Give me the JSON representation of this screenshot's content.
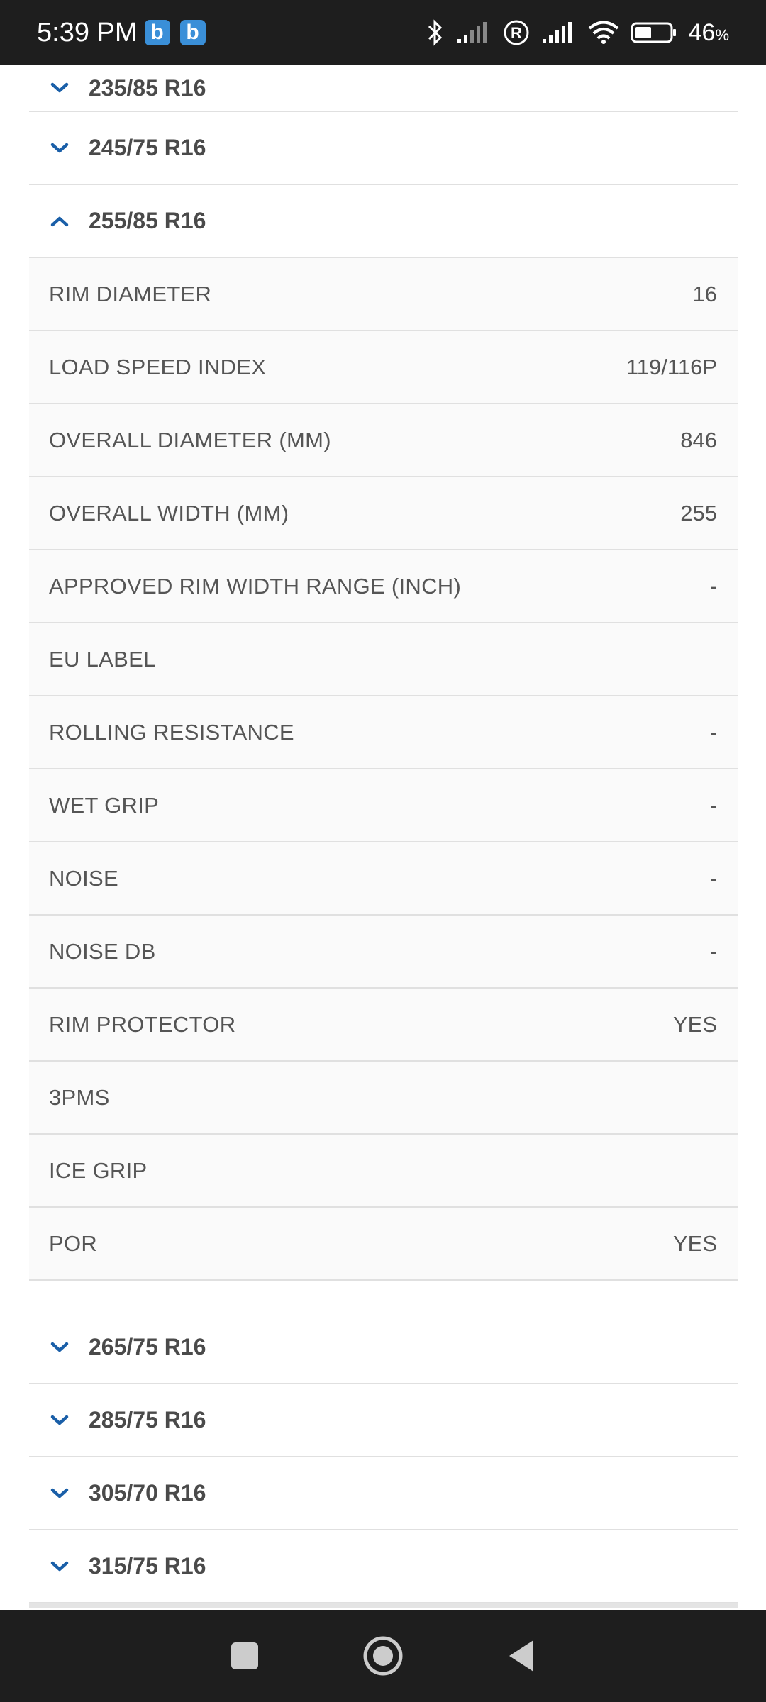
{
  "status_bar": {
    "time": "5:39 PM",
    "badges": [
      "b",
      "b"
    ],
    "battery_percent": "46",
    "battery_unit": "%"
  },
  "sizes_before": [
    {
      "label": "235/85 R16",
      "expanded": false
    },
    {
      "label": "245/75 R16",
      "expanded": false
    }
  ],
  "expanded_size": {
    "label": "255/85 R16",
    "expanded": true,
    "specs": [
      {
        "key": "RIM DIAMETER",
        "value": "16"
      },
      {
        "key": "LOAD SPEED INDEX",
        "value": "119/116P"
      },
      {
        "key": "OVERALL DIAMETER (MM)",
        "value": "846"
      },
      {
        "key": "OVERALL WIDTH (MM)",
        "value": "255"
      },
      {
        "key": "APPROVED RIM WIDTH RANGE (INCH)",
        "value": "-"
      },
      {
        "key": "EU LABEL",
        "value": ""
      },
      {
        "key": "ROLLING RESISTANCE",
        "value": "-"
      },
      {
        "key": "WET GRIP",
        "value": "-"
      },
      {
        "key": "NOISE",
        "value": "-"
      },
      {
        "key": "NOISE DB",
        "value": "-"
      },
      {
        "key": "RIM PROTECTOR",
        "value": "YES"
      },
      {
        "key": "3PMS",
        "value": ""
      },
      {
        "key": "ICE GRIP",
        "value": ""
      },
      {
        "key": "POR",
        "value": "YES"
      }
    ]
  },
  "sizes_after": [
    {
      "label": "265/75 R16",
      "expanded": false
    },
    {
      "label": "285/75 R16",
      "expanded": false
    },
    {
      "label": "305/70 R16",
      "expanded": false
    },
    {
      "label": "315/75 R16",
      "expanded": false
    }
  ],
  "colors": {
    "accent": "#1a5fa8",
    "status_bar_bg": "#1e1e1e",
    "divider": "#e0e0e0",
    "text": "#555555"
  },
  "icons": {
    "collapsed": "chevron-down-icon",
    "expanded": "chevron-up-icon"
  }
}
